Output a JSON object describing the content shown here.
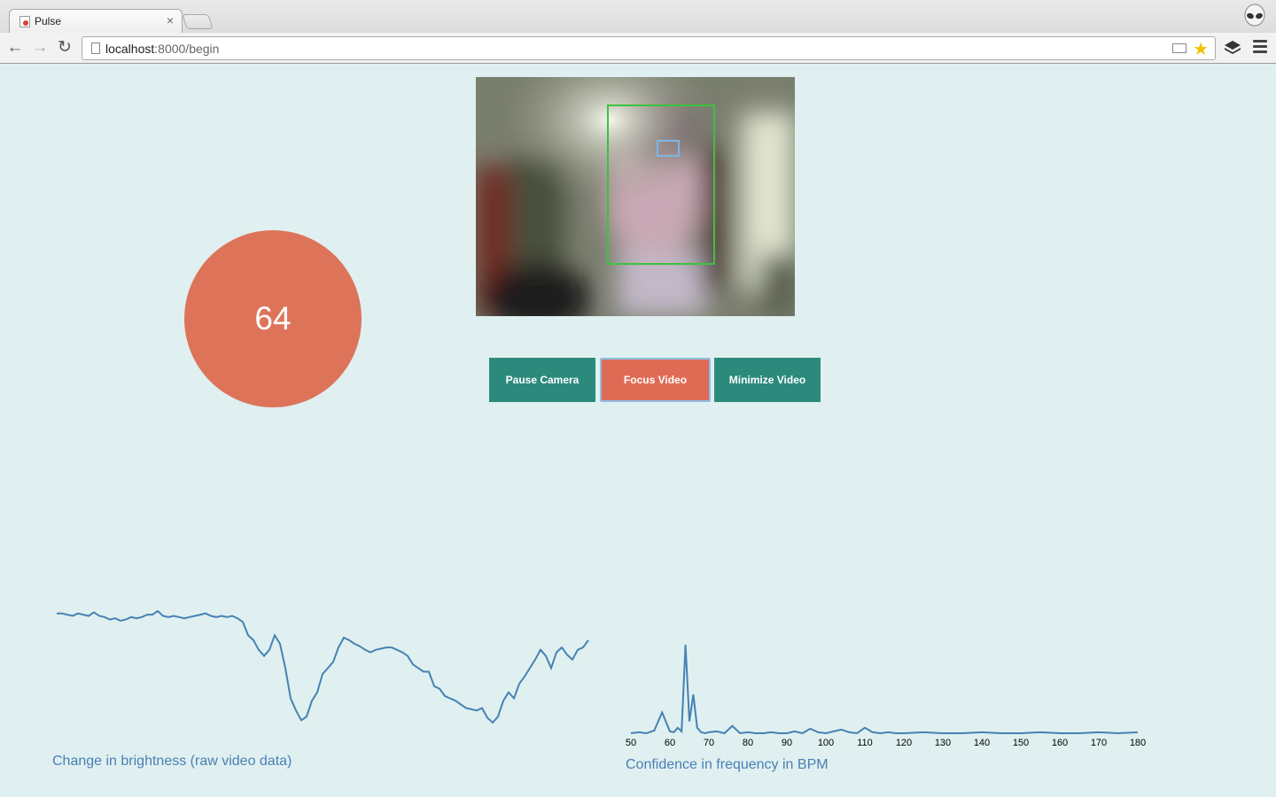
{
  "browser": {
    "tab_title": "Pulse",
    "tab_close": "×",
    "url_host": "localhost",
    "url_rest": ":8000/begin"
  },
  "bpm": {
    "value": "64"
  },
  "video": {
    "buttons": {
      "pause": "Pause Camera",
      "focus": "Focus Video",
      "minimize": "Minimize Video"
    }
  },
  "colors": {
    "background": "#e0f0f0",
    "accent_orange": "#dd745a",
    "teal": "#2c8a7c",
    "line": "#4682b4"
  },
  "chart_data": [
    {
      "type": "line",
      "title": "Change in brightness (raw video data)",
      "xlabel": "",
      "ylabel": "",
      "grid": false,
      "axes_visible": false,
      "x": [
        0,
        2,
        4,
        6,
        8,
        10,
        12,
        14,
        16,
        18,
        20,
        22,
        24,
        26,
        28,
        30,
        32,
        34,
        36,
        38,
        40,
        42,
        44,
        46,
        48,
        50,
        52,
        54,
        56,
        58,
        60,
        62,
        64,
        66,
        68,
        70,
        72,
        74,
        76,
        78,
        80,
        82,
        84,
        86,
        88,
        90,
        92,
        94,
        96,
        98,
        100,
        102,
        104,
        106,
        108,
        110,
        112,
        114,
        116,
        118,
        120,
        122,
        124,
        126,
        128,
        130,
        132,
        134,
        136,
        138,
        140,
        142,
        144,
        146,
        148,
        150,
        152,
        154,
        156,
        158,
        160,
        162,
        164,
        166,
        168,
        170,
        172,
        174,
        176,
        178,
        180,
        182,
        184,
        186,
        188,
        190,
        192,
        194,
        196,
        198,
        200
      ],
      "values": [
        100,
        100,
        99,
        98,
        100,
        99,
        98,
        101,
        98,
        97,
        95,
        96,
        94,
        95,
        97,
        96,
        97,
        99,
        99,
        102,
        98,
        97,
        98,
        97,
        96,
        97,
        98,
        99,
        100,
        98,
        97,
        98,
        97,
        98,
        96,
        93,
        82,
        78,
        70,
        65,
        70,
        82,
        75,
        55,
        30,
        20,
        12,
        15,
        28,
        35,
        50,
        55,
        60,
        72,
        80,
        78,
        75,
        73,
        70,
        68,
        70,
        71,
        72,
        72,
        70,
        68,
        65,
        58,
        55,
        52,
        52,
        40,
        38,
        32,
        30,
        28,
        25,
        22,
        21,
        20,
        22,
        14,
        10,
        15,
        28,
        35,
        30,
        42,
        48,
        55,
        62,
        70,
        65,
        55,
        68,
        72,
        66,
        62,
        70,
        72,
        78
      ]
    },
    {
      "type": "line",
      "title": "Confidence in frequency in BPM",
      "xlabel": "",
      "ylabel": "",
      "grid": false,
      "xlim": [
        50,
        180
      ],
      "x_ticks": [
        "50",
        "60",
        "70",
        "80",
        "90",
        "100",
        "110",
        "120",
        "130",
        "140",
        "150",
        "160",
        "170",
        "180"
      ],
      "x": [
        50,
        52,
        54,
        56,
        58,
        60,
        61,
        62,
        63,
        64,
        65,
        66,
        67,
        68,
        69,
        70,
        72,
        74,
        76,
        78,
        80,
        82,
        84,
        86,
        88,
        90,
        92,
        94,
        96,
        98,
        100,
        102,
        104,
        106,
        108,
        110,
        112,
        114,
        116,
        118,
        120,
        125,
        130,
        135,
        140,
        145,
        150,
        155,
        160,
        165,
        170,
        175,
        180
      ],
      "values": [
        2,
        3,
        2,
        5,
        25,
        4,
        3,
        8,
        4,
        100,
        15,
        45,
        8,
        3,
        2,
        3,
        4,
        2,
        10,
        2,
        3,
        2,
        2,
        3,
        2,
        2,
        4,
        2,
        7,
        3,
        2,
        4,
        6,
        3,
        2,
        8,
        3,
        2,
        3,
        2,
        2,
        3,
        2,
        2,
        3,
        2,
        2,
        3,
        2,
        2,
        3,
        2,
        3
      ]
    }
  ]
}
